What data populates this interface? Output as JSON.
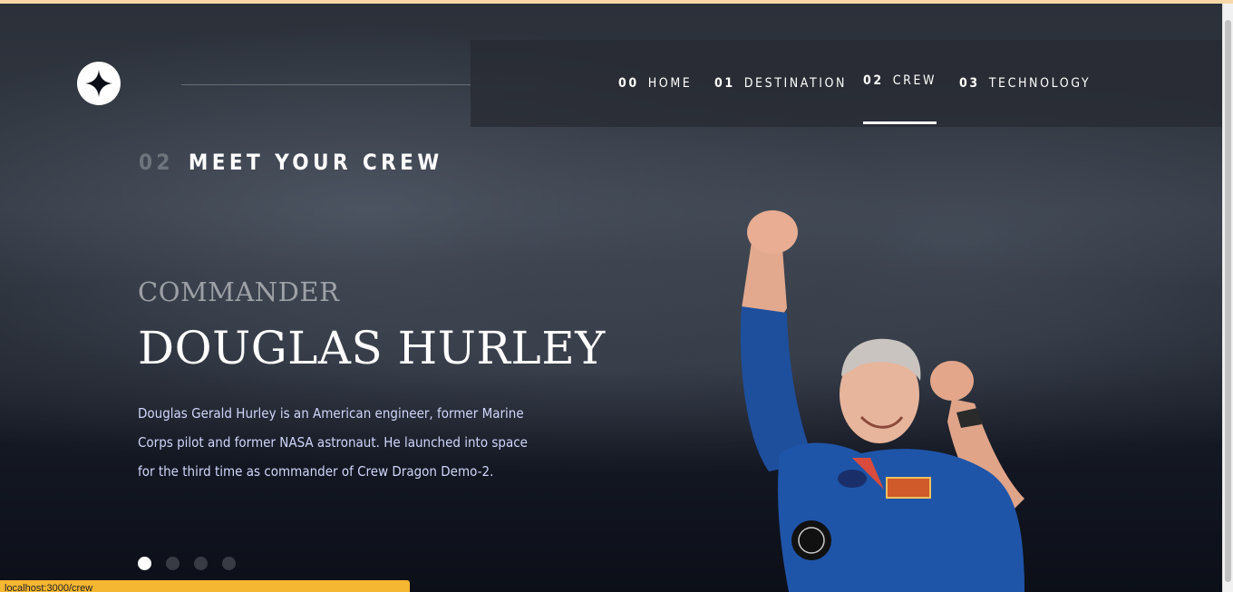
{
  "nav": {
    "items": [
      {
        "num": "00",
        "label": "HOME"
      },
      {
        "num": "01",
        "label": "DESTINATION"
      },
      {
        "num": "02",
        "label": "CREW"
      },
      {
        "num": "03",
        "label": "TECHNOLOGY"
      }
    ],
    "active_index": 2
  },
  "page": {
    "eyebrow_num": "02",
    "eyebrow_label": "MEET YOUR CREW"
  },
  "crew": {
    "role": "COMMANDER",
    "name": "DOUGLAS HURLEY",
    "bio": "Douglas Gerald Hurley is an American engineer, former Marine Corps pilot and former NASA astronaut. He launched into space for the third time as commander of Crew Dragon Demo-2."
  },
  "carousel": {
    "count": 4,
    "active_index": 0
  },
  "status_bar": {
    "url": "localhost:3000/crew"
  },
  "icons": {
    "logo": "four-point-star-icon"
  },
  "colors": {
    "background": "#0b0d17",
    "accent_text": "#d0d6f9",
    "status_bar": "#f5b731"
  }
}
